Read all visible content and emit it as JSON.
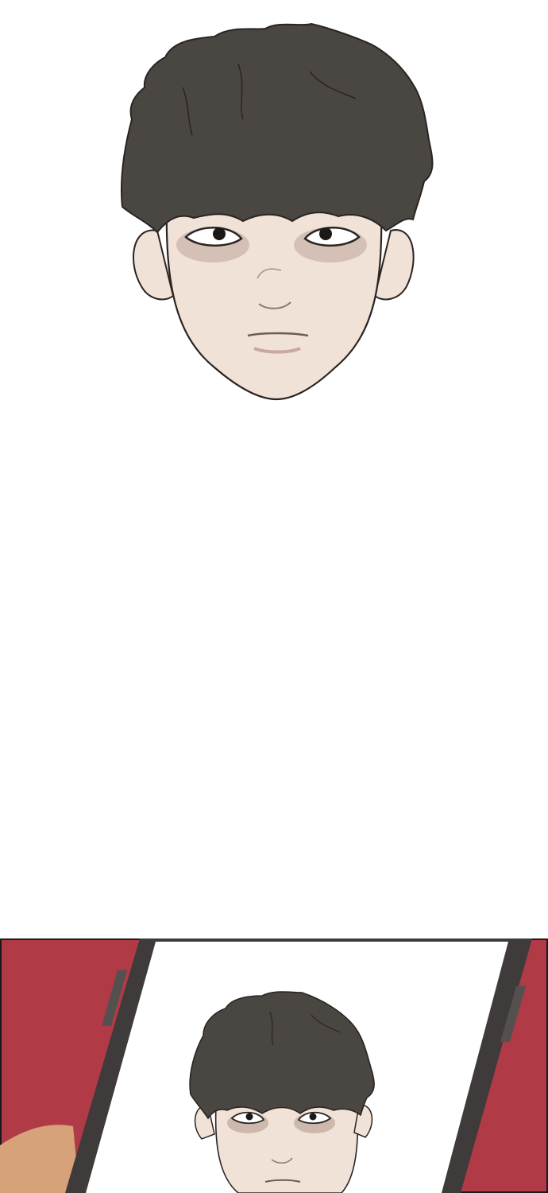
{
  "comic": {
    "panels": [
      {
        "id": "panel-1",
        "subject": "portrait-face",
        "background_color": "#ffffff"
      },
      {
        "id": "panel-2",
        "subject": "phone-screen-with-same-face",
        "background_color": "#b03a45"
      }
    ]
  },
  "colors": {
    "hair": "#4a4642",
    "hair_dark": "#3a3633",
    "skin": "#f1e2d7",
    "skin_shadow": "#d9c5b8",
    "eye_bag": "#b7a49b",
    "lip": "#c9a9a0",
    "outline": "#2a2422",
    "panel_red": "#b03a45",
    "phone_body": "#3f3b3b",
    "phone_screen": "#ffffff",
    "hand": "#d6a27a"
  }
}
